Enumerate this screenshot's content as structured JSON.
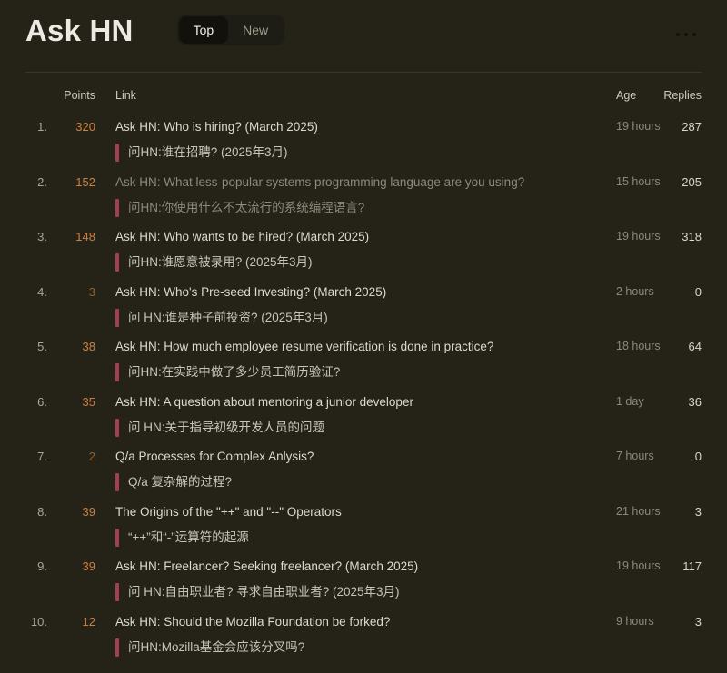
{
  "app": {
    "title": "Ask HN",
    "tabs": [
      {
        "label": "Top",
        "active": true
      },
      {
        "label": "New",
        "active": false
      }
    ]
  },
  "colors": {
    "background": "#252318",
    "points_accent": "#cd8042",
    "points_accent_dim": "#90602c",
    "translation_bar": "#a23f54",
    "visited_text": "#8e897b"
  },
  "table": {
    "headers": {
      "points": "Points",
      "link": "Link",
      "age": "Age",
      "replies": "Replies"
    },
    "rows": [
      {
        "rank": "1.",
        "points": "320",
        "title": "Ask HN: Who is hiring? (March 2025)",
        "translation": "问HN:谁在招聘? (2025年3月)",
        "age": "19 hours",
        "replies": "287",
        "visited": false,
        "points_dim": false
      },
      {
        "rank": "2.",
        "points": "152",
        "title": "Ask HN: What less-popular systems programming language are you using?",
        "translation": "问HN:你使用什么不太流行的系统编程语言?",
        "age": "15 hours",
        "replies": "205",
        "visited": true,
        "points_dim": false
      },
      {
        "rank": "3.",
        "points": "148",
        "title": "Ask HN: Who wants to be hired? (March 2025)",
        "translation": "问HN:谁愿意被录用? (2025年3月)",
        "age": "19 hours",
        "replies": "318",
        "visited": false,
        "points_dim": false
      },
      {
        "rank": "4.",
        "points": "3",
        "title": "Ask HN: Who's Pre-seed Investing? (March 2025)",
        "translation": "问 HN:谁是种子前投资? (2025年3月)",
        "age": "2 hours",
        "replies": "0",
        "visited": false,
        "points_dim": true
      },
      {
        "rank": "5.",
        "points": "38",
        "title": "Ask HN: How much employee resume verification is done in practice?",
        "translation": "问HN:在实践中做了多少员工简历验证?",
        "age": "18 hours",
        "replies": "64",
        "visited": false,
        "points_dim": false
      },
      {
        "rank": "6.",
        "points": "35",
        "title": "Ask HN: A question about mentoring a junior developer",
        "translation": "问 HN:关于指导初级开发人员的问题",
        "age": "1 day",
        "replies": "36",
        "visited": false,
        "points_dim": false
      },
      {
        "rank": "7.",
        "points": "2",
        "title": "Q/a Processes for Complex Anlysis?",
        "translation": "Q/a 复杂解的过程?",
        "age": "7 hours",
        "replies": "0",
        "visited": false,
        "points_dim": true
      },
      {
        "rank": "8.",
        "points": "39",
        "title": "The Origins of the \"++\" and \"--\" Operators",
        "translation": "“++”和“-”运算符的起源",
        "age": "21 hours",
        "replies": "3",
        "visited": false,
        "points_dim": false
      },
      {
        "rank": "9.",
        "points": "39",
        "title": "Ask HN: Freelancer? Seeking freelancer? (March 2025)",
        "translation": "问 HN:自由职业者? 寻求自由职业者? (2025年3月)",
        "age": "19 hours",
        "replies": "117",
        "visited": false,
        "points_dim": false
      },
      {
        "rank": "10.",
        "points": "12",
        "title": "Ask HN: Should the Mozilla Foundation be forked?",
        "translation": "问HN:Mozilla基金会应该分叉吗?",
        "age": "9 hours",
        "replies": "3",
        "visited": false,
        "points_dim": false
      }
    ]
  }
}
